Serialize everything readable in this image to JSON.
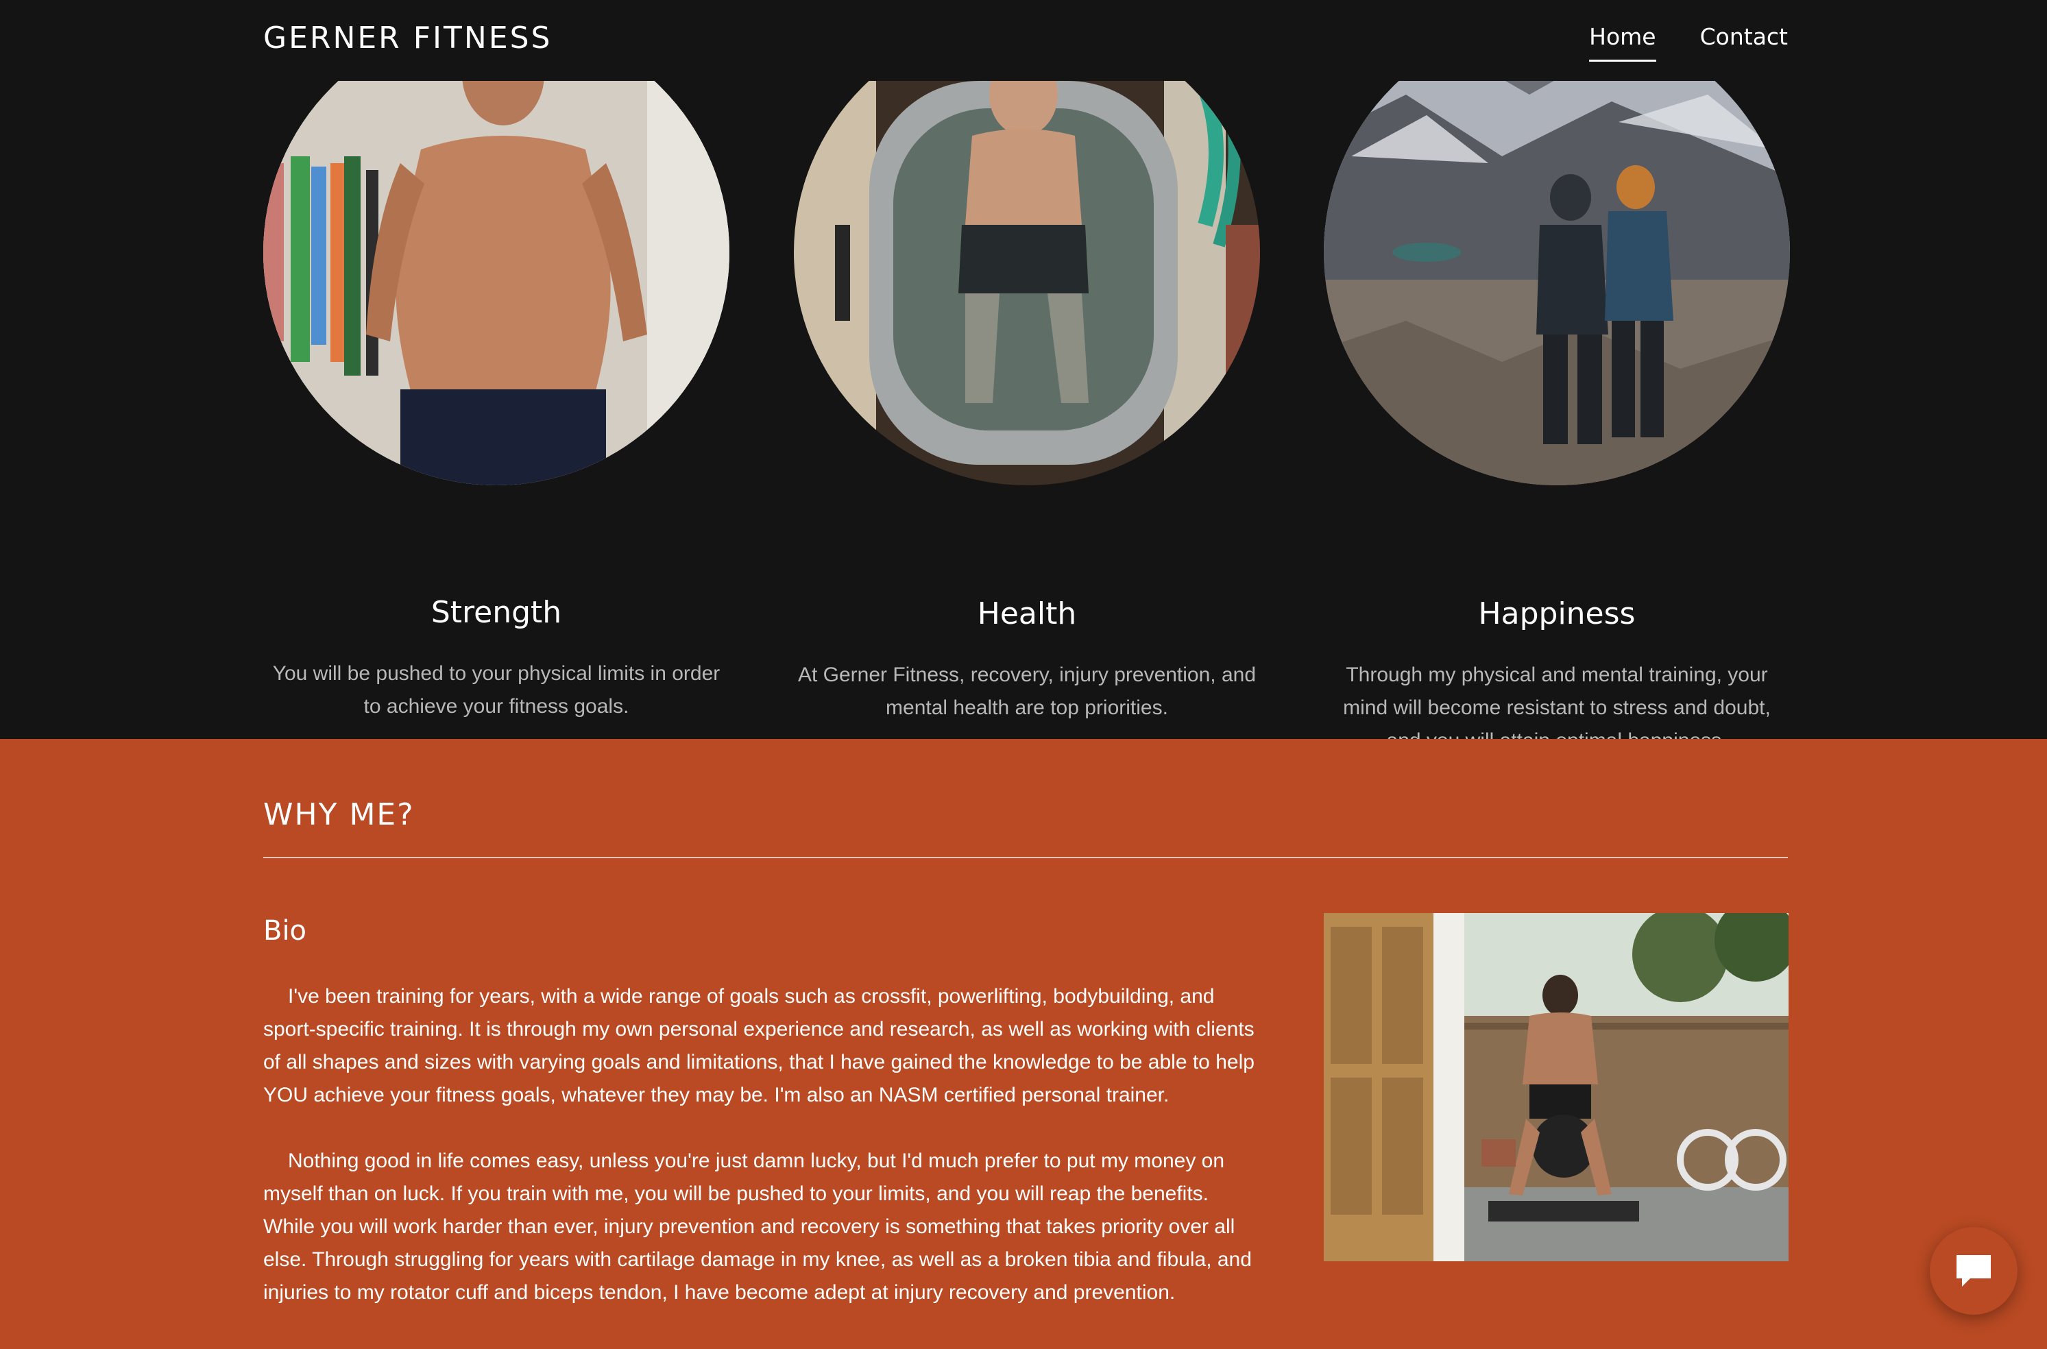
{
  "header": {
    "brand": "GERNER FITNESS",
    "nav": [
      {
        "label": "Home",
        "active": true
      },
      {
        "label": "Contact",
        "active": false
      }
    ]
  },
  "features": [
    {
      "title": "Strength",
      "text": "You will be pushed to your physical limits in order to achieve your fitness goals.",
      "image": "shirtless-man-standing-photo"
    },
    {
      "title": "Health",
      "text": "At Gerner Fitness, recovery, injury prevention, and mental health are top priorities.",
      "image": "ice-bath-tub-photo"
    },
    {
      "title": "Happiness",
      "text": "Through my physical and mental training, your mind will become resistant to stress and doubt, and you will attain optimal happiness.",
      "image": "two-hikers-mountain-photo"
    }
  ],
  "why_me": {
    "title": "WHY ME?",
    "bio_title": "Bio",
    "paragraphs": [
      "I've been training for years, with a wide range of goals such as crossfit, powerlifting, bodybuilding, and sport-specific training. It is through my own personal experience and research, as well as working with clients of all shapes and sizes with varying goals and limitations, that I have gained the knowledge to be able to help YOU achieve your fitness goals, whatever they may be. I'm also an NASM certified personal trainer.",
      "Nothing good in life comes easy, unless you're just damn lucky, but I'd much prefer to put my money on myself than on luck. If you train with me, you will be pushed to your limits, and you will reap the benefits. While you will work harder than ever, injury prevention and recovery is something that takes priority over all else. Through struggling for years with cartilage damage in my knee, as well as a broken tibia and fibula, and injuries to my rotator cuff and biceps tendon, I have become adept at injury recovery and prevention."
    ],
    "image": "medicine-ball-workout-photo"
  },
  "chat": {
    "icon": "chat-bubble-icon"
  },
  "colors": {
    "background": "#141414",
    "accent": "#b94a23",
    "text_light": "#ffffff",
    "text_muted": "#b8b8b8"
  }
}
